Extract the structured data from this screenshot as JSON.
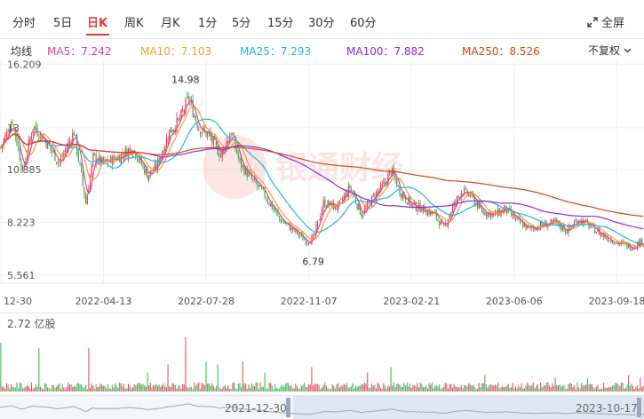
{
  "tabs": [
    "分时",
    "5日",
    "日K",
    "周K",
    "月K",
    "1分",
    "5分",
    "15分",
    "30分",
    "60分"
  ],
  "active_tab": "日K",
  "fullscreen_label": "全屏",
  "ma": {
    "title": "均线",
    "items": [
      {
        "label": "MA5：7.242",
        "color": "#e040a0"
      },
      {
        "label": "MA10：7.103",
        "color": "#f0a030"
      },
      {
        "label": "MA25：7.293",
        "color": "#20b8d8"
      },
      {
        "label": "MA100：7.882",
        "color": "#8a2be2"
      },
      {
        "label": "MA250：8.526",
        "color": "#d84315"
      }
    ]
  },
  "adjust_label": "不复权",
  "watermark": "银通财经",
  "colors": {
    "up": "#e53950",
    "down": "#2bb24c"
  },
  "volume_label": "2.72 亿股",
  "navigator": {
    "start": "2021-12-30",
    "end": "2023-10-17"
  },
  "chart_data": {
    "type": "candlestick",
    "y_ticks": [
      "16.209",
      "13",
      "10.885",
      "8.223",
      "5.561"
    ],
    "x_ticks": [
      "12-30",
      "2022-04-13",
      "2022-07-28",
      "2022-11-07",
      "2023-02-21",
      "2023-06-06",
      "2023-09-18"
    ],
    "annotations": [
      {
        "label": "14.98",
        "x": "2022-07-08",
        "y": 14.98
      },
      {
        "label": "6.79",
        "x": "2022-11-02",
        "y": 6.79
      }
    ],
    "ylim": [
      5.2,
      16.4
    ],
    "series": [
      {
        "name": "MA5",
        "values": [
          7.242
        ]
      },
      {
        "name": "MA10",
        "values": [
          7.103
        ]
      },
      {
        "name": "MA25",
        "values": [
          7.293
        ]
      },
      {
        "name": "MA100",
        "values": [
          7.882
        ]
      },
      {
        "name": "MA250",
        "values": [
          8.526
        ]
      }
    ],
    "anchors": [
      [
        0,
        12.0
      ],
      [
        8,
        13.4
      ],
      [
        15,
        10.8
      ],
      [
        22,
        13.1
      ],
      [
        30,
        12.4
      ],
      [
        40,
        11.2
      ],
      [
        50,
        12.8
      ],
      [
        58,
        9.2
      ],
      [
        63,
        11.5
      ],
      [
        70,
        11.2
      ],
      [
        80,
        11.5
      ],
      [
        90,
        12.0
      ],
      [
        100,
        10.6
      ],
      [
        106,
        11.0
      ],
      [
        115,
        12.8
      ],
      [
        122,
        13.4
      ],
      [
        128,
        14.5
      ],
      [
        135,
        13.0
      ],
      [
        142,
        12.6
      ],
      [
        150,
        11.6
      ],
      [
        157,
        12.8
      ],
      [
        163,
        11.2
      ],
      [
        172,
        10.3
      ],
      [
        180,
        9.6
      ],
      [
        190,
        8.4
      ],
      [
        200,
        7.8
      ],
      [
        208,
        7.3
      ],
      [
        213,
        7.4
      ],
      [
        220,
        9.2
      ],
      [
        230,
        9.0
      ],
      [
        238,
        10.0
      ],
      [
        246,
        8.6
      ],
      [
        254,
        9.5
      ],
      [
        262,
        10.2
      ],
      [
        266,
        10.9
      ],
      [
        272,
        9.8
      ],
      [
        280,
        9.1
      ],
      [
        288,
        8.9
      ],
      [
        296,
        8.6
      ],
      [
        302,
        7.9
      ],
      [
        308,
        9.0
      ],
      [
        314,
        9.8
      ],
      [
        320,
        9.6
      ],
      [
        328,
        8.8
      ],
      [
        336,
        8.6
      ],
      [
        344,
        8.9
      ],
      [
        352,
        8.3
      ],
      [
        360,
        7.9
      ],
      [
        370,
        8.1
      ],
      [
        378,
        8.2
      ],
      [
        386,
        7.8
      ],
      [
        394,
        8.4
      ],
      [
        402,
        8.0
      ],
      [
        410,
        7.6
      ],
      [
        420,
        7.2
      ],
      [
        430,
        7.0
      ],
      [
        438,
        7.3
      ]
    ],
    "vol_spikes": [
      [
        0,
        0.9
      ],
      [
        26,
        0.8
      ],
      [
        60,
        0.8
      ],
      [
        100,
        0.35
      ],
      [
        114,
        0.5
      ],
      [
        126,
        1.0
      ],
      [
        140,
        0.55
      ],
      [
        148,
        0.5
      ],
      [
        165,
        0.55
      ],
      [
        180,
        0.35
      ],
      [
        212,
        0.45
      ],
      [
        250,
        0.35
      ],
      [
        266,
        0.45
      ],
      [
        330,
        0.3
      ],
      [
        378,
        0.25
      ],
      [
        400,
        0.25
      ],
      [
        428,
        0.3
      ],
      [
        436,
        0.25
      ]
    ]
  }
}
